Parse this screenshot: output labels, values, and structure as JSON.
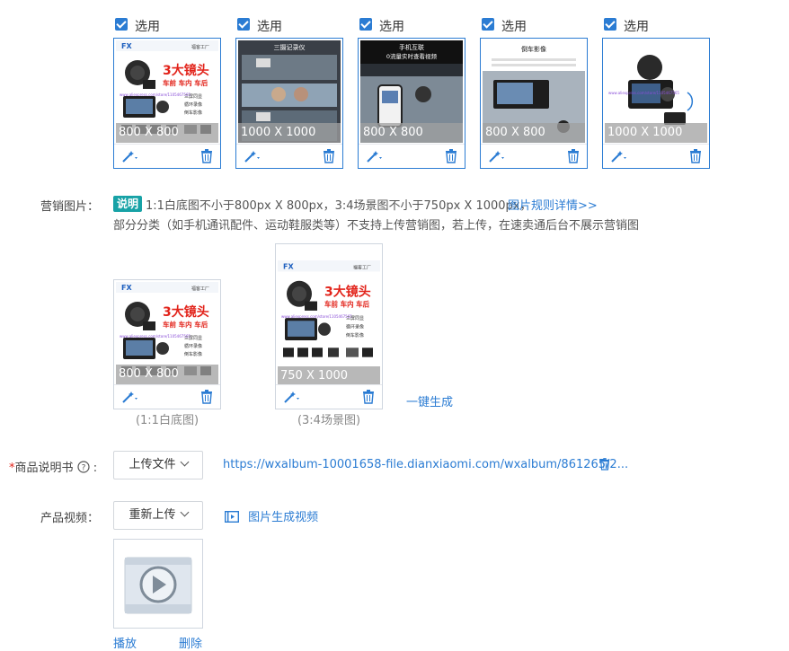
{
  "gallery": {
    "select_label": "选用",
    "items": [
      {
        "dimension": "800 X 800",
        "variant": "product",
        "head": ""
      },
      {
        "dimension": "1000 X 1000",
        "variant": "collage",
        "head": "三摄记录仪"
      },
      {
        "dimension": "800 X 800",
        "variant": "phone",
        "head": "手机互联",
        "sub": "0流量实时查看视频"
      },
      {
        "dimension": "800 X 800",
        "variant": "reverse",
        "head": "倒车影像"
      },
      {
        "dimension": "1000 X 1000",
        "variant": "device",
        "head": ""
      }
    ]
  },
  "marketing": {
    "label": "营销图片：",
    "badge": "说明",
    "rule_text": "1:1白底图不小于800px X 800px，3:4场景图不小于750px X 1000px，",
    "rule_link": "图片规则详情>>",
    "note": "部分分类（如手机通讯配件、运动鞋服类等）不支持上传营销图，若上传，在速卖通后台不展示营销图",
    "square_dimension": "800 X 800",
    "square_caption": "(1:1白底图)",
    "portrait_dimension": "750 X 1000",
    "portrait_caption": "(3:4场景图)",
    "generate_link": "一键生成"
  },
  "promo": {
    "brand": "FX",
    "brand_tag": "福客工厂",
    "headline": "3大镜头",
    "subline": "车前 车内 车后",
    "watermark": "www.aliexpress.com/store/1105467565",
    "features": [
      "三屏同显",
      "循环录像",
      "倒车影像"
    ]
  },
  "manual": {
    "required_mark": "*",
    "label": "商品说明书",
    "upload_button": "上传文件",
    "file_url": "https://wxalbum-10001658-file.dianxiaomi.com/wxalbum/861265/2..."
  },
  "video": {
    "label": "产品视频：",
    "reupload_button": "重新上传",
    "generate_label": "图片生成视频",
    "play_link": "播放",
    "delete_link": "删除"
  },
  "colors": {
    "accent": "#2b7cd3",
    "badge": "#17a2a6",
    "promo_red": "#e2231a"
  }
}
